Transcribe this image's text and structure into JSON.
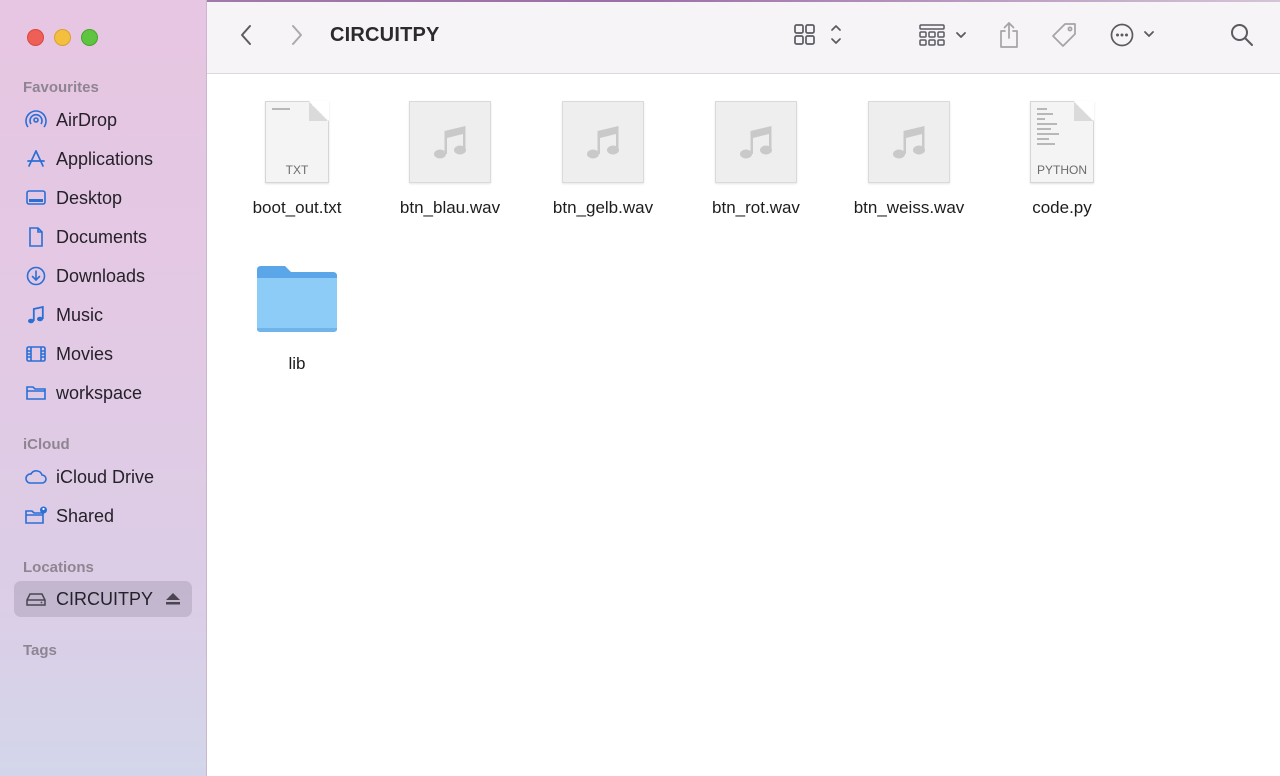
{
  "window": {
    "title": "CIRCUITPY"
  },
  "sidebar": {
    "sections": [
      {
        "title": "Favourites",
        "items": [
          {
            "label": "AirDrop",
            "icon": "airdrop-icon"
          },
          {
            "label": "Applications",
            "icon": "applications-icon"
          },
          {
            "label": "Desktop",
            "icon": "desktop-icon"
          },
          {
            "label": "Documents",
            "icon": "document-icon"
          },
          {
            "label": "Downloads",
            "icon": "download-icon"
          },
          {
            "label": "Music",
            "icon": "music-note-icon"
          },
          {
            "label": "Movies",
            "icon": "film-icon"
          },
          {
            "label": "workspace",
            "icon": "folder-icon"
          }
        ]
      },
      {
        "title": "iCloud",
        "items": [
          {
            "label": "iCloud Drive",
            "icon": "cloud-icon"
          },
          {
            "label": "Shared",
            "icon": "shared-folder-icon"
          }
        ]
      },
      {
        "title": "Locations",
        "items": [
          {
            "label": "CIRCUITPY",
            "icon": "drive-icon",
            "selected": true,
            "eject": true
          }
        ]
      },
      {
        "title": "Tags",
        "items": []
      }
    ]
  },
  "toolbar": {
    "back": "chevron-left-icon",
    "forward": "chevron-right-icon",
    "view_mode": "grid-view-icon",
    "group": "group-by-icon",
    "share": "share-icon",
    "tag": "tag-icon",
    "more": "ellipsis-circle-icon",
    "search": "search-icon"
  },
  "files": [
    {
      "name": "boot_out.txt",
      "kind": "text",
      "tag": "TXT"
    },
    {
      "name": "btn_blau.wav",
      "kind": "audio"
    },
    {
      "name": "btn_gelb.wav",
      "kind": "audio"
    },
    {
      "name": "btn_rot.wav",
      "kind": "audio"
    },
    {
      "name": "btn_weiss.wav",
      "kind": "audio"
    },
    {
      "name": "code.py",
      "kind": "python",
      "tag": "PYTHON"
    },
    {
      "name": "lib",
      "kind": "folder"
    }
  ],
  "colors": {
    "sidebar_accent": "#2a6fd6",
    "folder": "#7fc4f5",
    "close": "#ee5f57",
    "minimize": "#f4be3f",
    "maximize": "#5fc43f"
  }
}
